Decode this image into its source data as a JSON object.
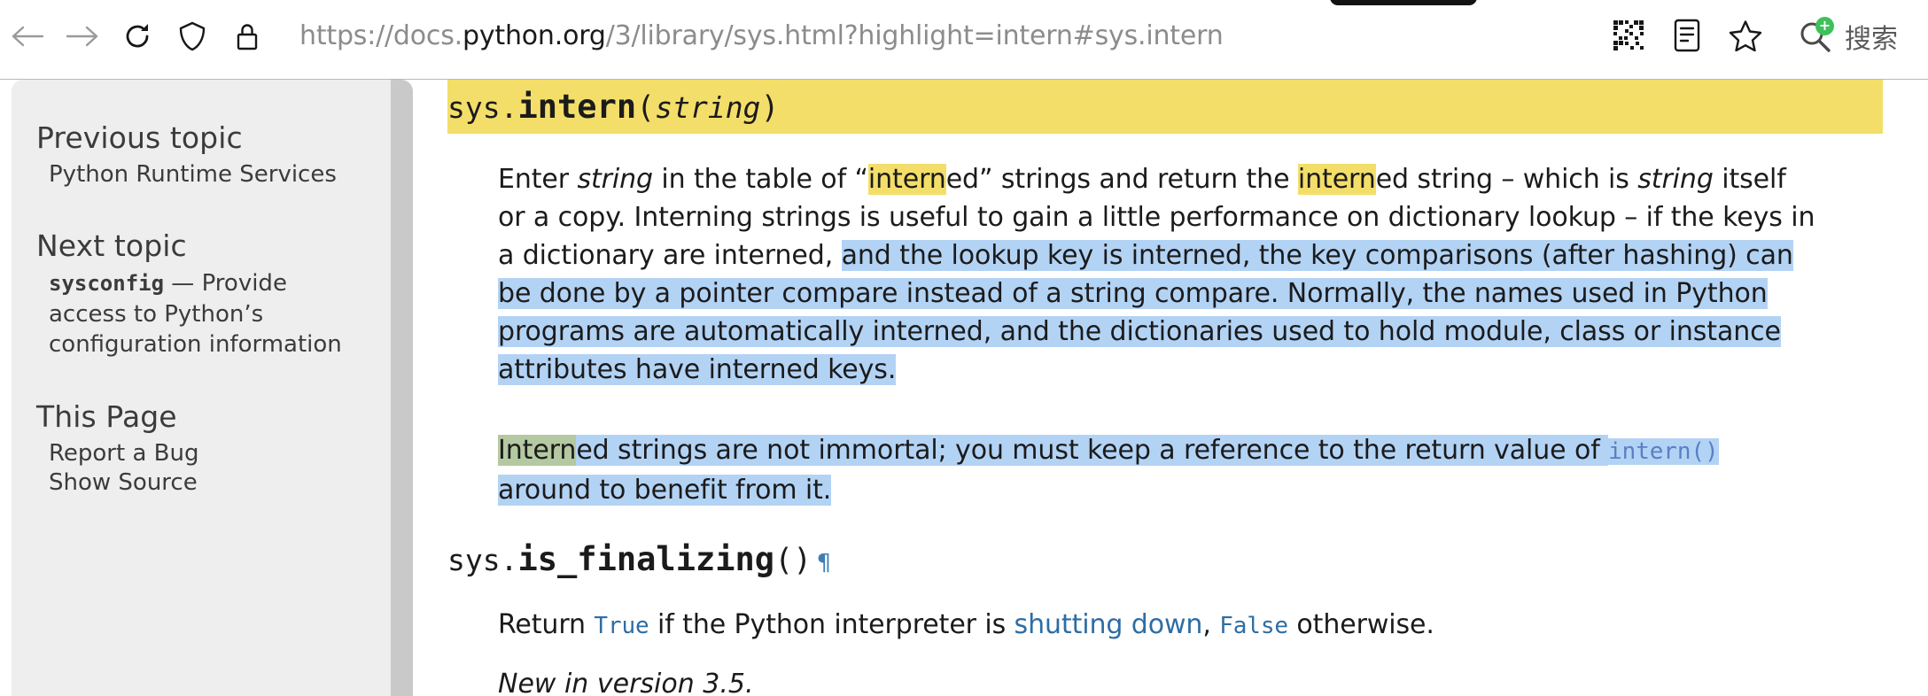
{
  "browser": {
    "url_prefix": "https://docs.",
    "url_host": "python.org",
    "url_suffix": "/3/library/sys.html?highlight=intern#sys.intern",
    "url_full": "https://docs.python.org/3/library/sys.html?highlight=intern#sys.intern",
    "back_label": "Back",
    "forward_label": "Forward",
    "reload_label": "Reload",
    "shield_label": "Tracking protection",
    "lock_label": "Site security",
    "qr_label": "QR code",
    "reader_label": "Reader view",
    "bookmark_label": "Bookmark",
    "search_label": "搜索"
  },
  "sidebar": {
    "blocks": [
      {
        "heading": "Previous topic",
        "link": "Python Runtime Services"
      },
      {
        "heading": "Next topic",
        "link_code": "sysconfig",
        "link_rest": " — Provide access to Python’s configuration information"
      },
      {
        "heading": "This Page",
        "links": [
          "Report a Bug",
          "Show Source"
        ]
      }
    ]
  },
  "content": {
    "entries": [
      {
        "prefix": "sys.",
        "name": "intern",
        "open_paren": "(",
        "param": "string",
        "close_paren": ")",
        "paragraphs": [
          {
            "segments": [
              {
                "text": "Enter ",
                "style": "plain"
              },
              {
                "text": "string",
                "style": "italic"
              },
              {
                "text": " in the table of “",
                "style": "plain"
              },
              {
                "text": "intern",
                "style": "yellow"
              },
              {
                "text": "ed” strings and return the ",
                "style": "plain"
              },
              {
                "text": "intern",
                "style": "yellow"
              },
              {
                "text": "ed string – which is ",
                "style": "plain"
              },
              {
                "text": "string",
                "style": "italic"
              },
              {
                "text": " itself or a copy. Interning strings is useful to gain a little performance on dictionary lookup – if the keys in a dictionary are interned, ",
                "style": "plain"
              },
              {
                "text": "and the lookup key is interned, the key comparisons (after hashing) can be done by a pointer compare instead of a string compare. Normally, the names used in Python programs are automatically interned, and the dictionaries used to hold module, class or instance attributes have interned keys.",
                "style": "selected"
              }
            ]
          },
          {
            "segments": [
              {
                "text": "Intern",
                "style": "green"
              },
              {
                "text": "ed strings are not immortal; you must keep a reference to the return value of ",
                "style": "selected"
              },
              {
                "text": "intern()",
                "style": "selected-code-link"
              },
              {
                "text": " around to benefit from it.",
                "style": "selected"
              }
            ]
          }
        ]
      },
      {
        "prefix": "sys.",
        "name": "is_finalizing",
        "open_paren": "(",
        "param": "",
        "close_paren": ")",
        "anchor": "¶",
        "paragraphs": [
          {
            "segments": [
              {
                "text": "Return ",
                "style": "plain"
              },
              {
                "text": "True",
                "style": "code-link"
              },
              {
                "text": " if the Python interpreter is ",
                "style": "plain"
              },
              {
                "text": "shutting down",
                "style": "link"
              },
              {
                "text": ", ",
                "style": "plain"
              },
              {
                "text": "False",
                "style": "code-link"
              },
              {
                "text": " otherwise.",
                "style": "plain"
              }
            ]
          }
        ],
        "version_note": "New in version 3.5."
      }
    ]
  },
  "colors": {
    "highlight_yellow": "#f4de6a",
    "selection_blue": "#b3d3f5",
    "blend_green": "#b4c9a1",
    "link_blue": "#2e6da4",
    "code_link_blue": "#5a7fc4",
    "sidebar_bg": "#eeeeee",
    "scrollbar": "#c9c9c9",
    "badge_green": "#3fc05b"
  }
}
